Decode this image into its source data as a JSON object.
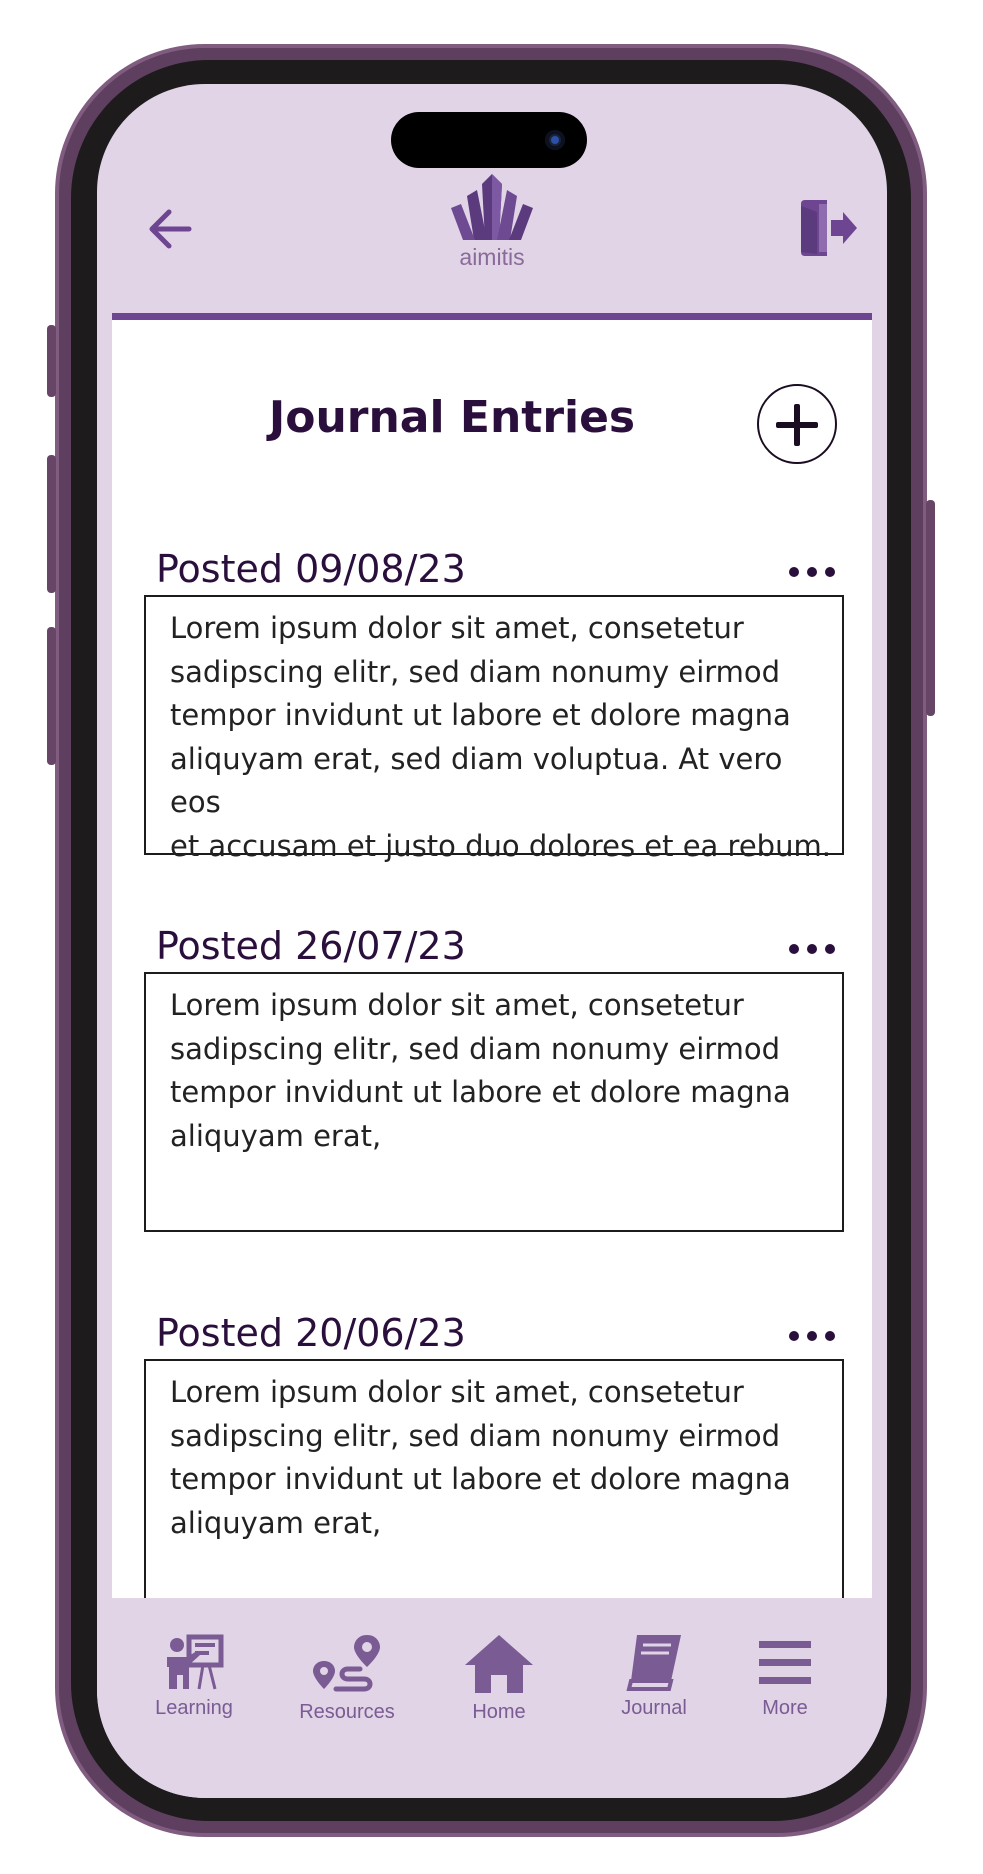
{
  "header": {
    "logo_text": "aimitis",
    "back_icon": "arrow-left-icon",
    "logout_icon": "logout-door-icon"
  },
  "page": {
    "title": "Journal Entries",
    "add_icon": "plus-circle-icon"
  },
  "entries": [
    {
      "date": "Posted 09/08/23",
      "text": "Lorem ipsum dolor sit amet, consetetur\nsadipscing elitr, sed diam nonumy eirmod\ntempor invidunt ut labore et dolore magna\naliquyam erat, sed diam voluptua. At vero eos\net accusam et justo duo dolores et ea rebum.",
      "menu_icon": "more-dots-icon"
    },
    {
      "date": "Posted 26/07/23",
      "text": "Lorem ipsum dolor sit amet, consetetur\nsadipscing elitr, sed diam nonumy eirmod\ntempor invidunt ut labore et dolore magna\naliquyam erat,",
      "menu_icon": "more-dots-icon"
    },
    {
      "date": "Posted 20/06/23",
      "text": "Lorem ipsum dolor sit amet, consetetur\nsadipscing elitr, sed diam nonumy eirmod\ntempor invidunt ut labore et dolore magna\naliquyam erat,",
      "menu_icon": "more-dots-icon"
    }
  ],
  "nav": {
    "items": [
      {
        "label": "Learning",
        "icon": "learning-presenter-icon"
      },
      {
        "label": "Resources",
        "icon": "route-map-icon"
      },
      {
        "label": "Home",
        "icon": "home-icon"
      },
      {
        "label": "Journal",
        "icon": "book-icon"
      },
      {
        "label": "More",
        "icon": "hamburger-menu-icon"
      }
    ]
  },
  "colors": {
    "accent": "#6e4591",
    "screen_bg": "#e0d4e6",
    "title_text": "#2a0f3d",
    "nav_icon": "#7a5b94"
  }
}
